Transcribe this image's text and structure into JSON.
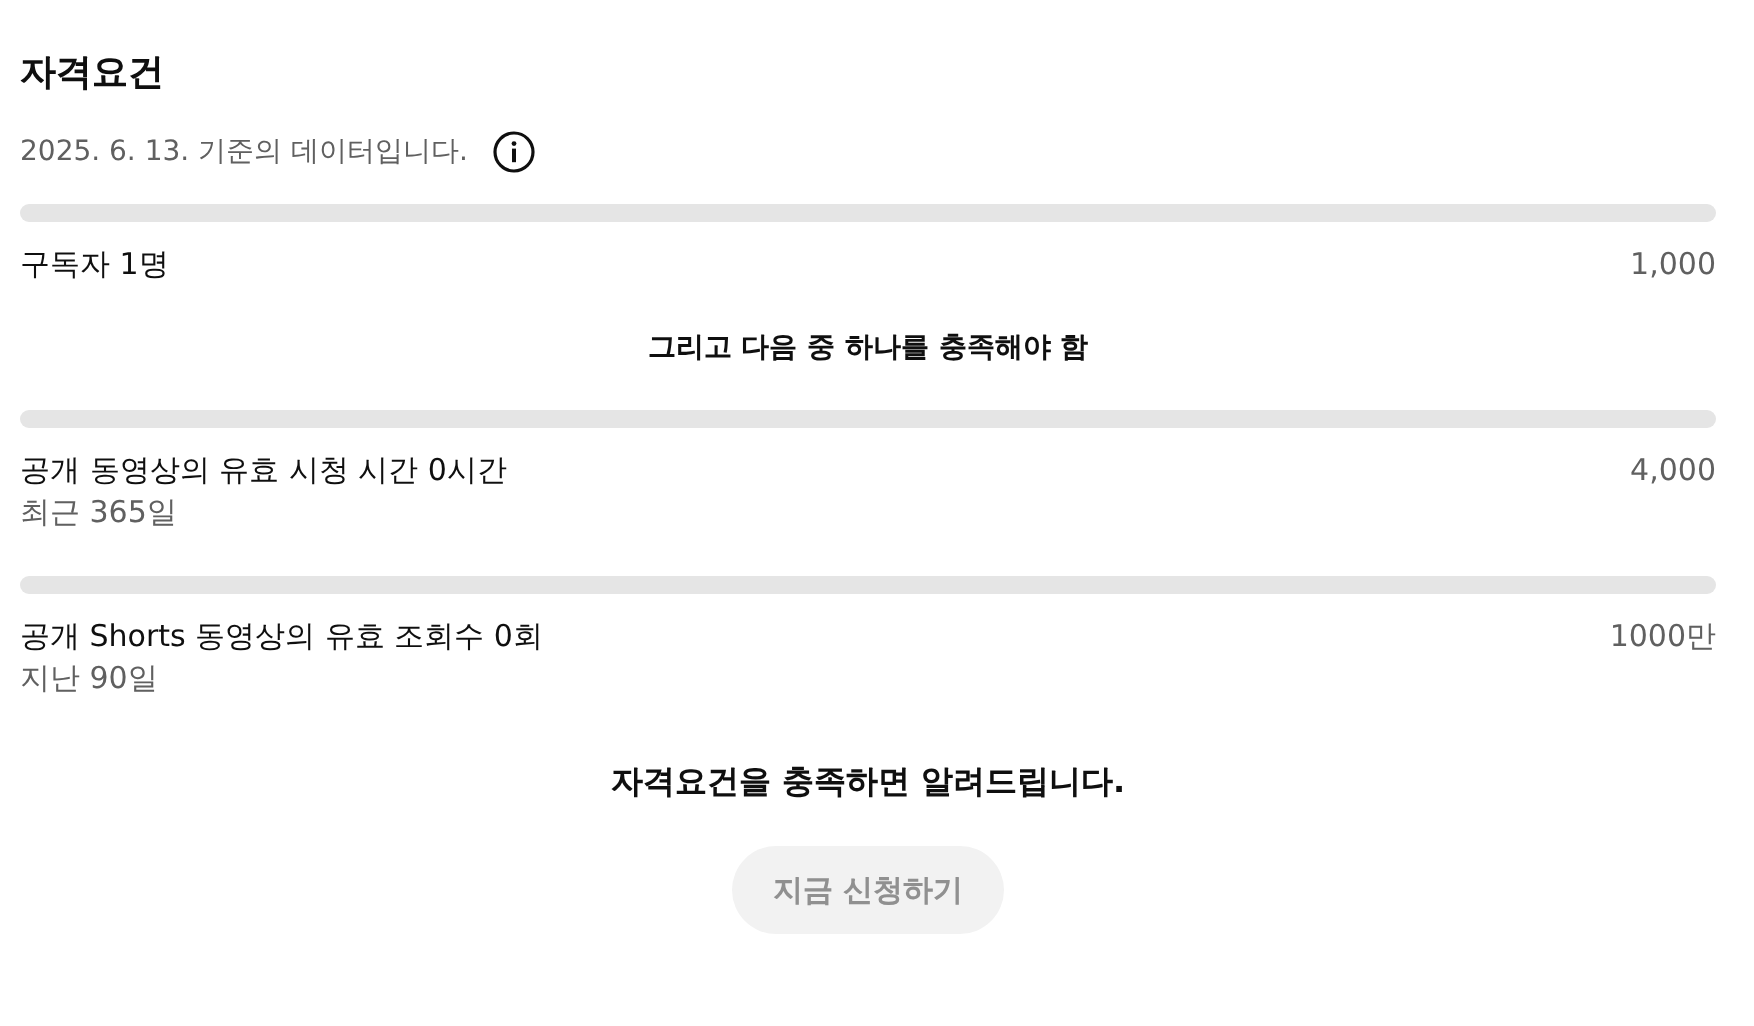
{
  "title": "자격요건",
  "as_of": "2025. 6. 13. 기준의 데이터입니다.",
  "requirements": [
    {
      "kind": "main",
      "label": "구독자 1명",
      "target": "1,000"
    },
    {
      "kind": "divider",
      "text": "그리고 다음 중 하나를 충족해야 함"
    },
    {
      "kind": "main",
      "label": "공개 동영상의 유효 시청 시간 0시간",
      "sublabel": "최근 365일",
      "target": "4,000"
    },
    {
      "kind": "main",
      "label": "공개 Shorts 동영상의 유효 조회수 0회",
      "sublabel": "지난 90일",
      "target": "1000만"
    }
  ],
  "notice": "자격요건을 충족하면 알려드립니다.",
  "apply_button": {
    "label": "지금 신청하기",
    "disabled": true
  }
}
